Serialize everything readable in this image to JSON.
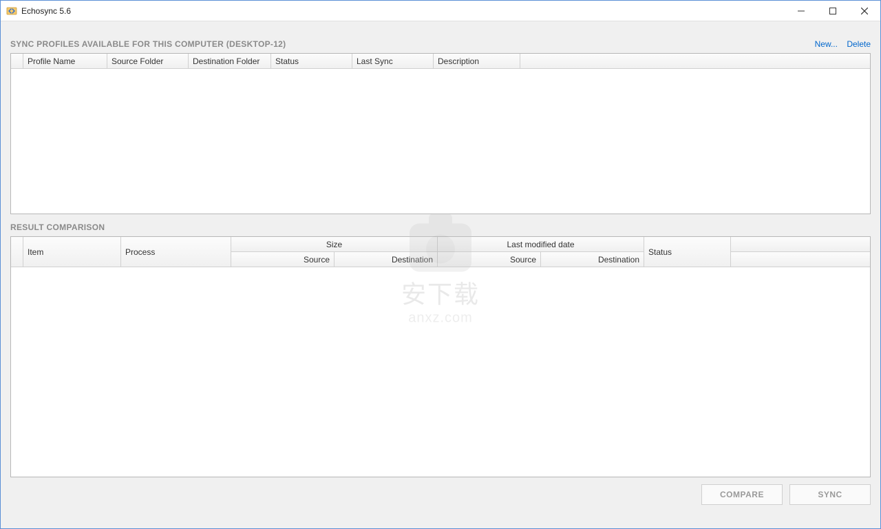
{
  "window": {
    "title": "Echosync 5.6"
  },
  "sections": {
    "profiles_title": "SYNC PROFILES AVAILABLE FOR THIS COMPUTER (DESKTOP-12)",
    "results_title": "RESULT COMPARISON"
  },
  "links": {
    "new": "New...",
    "delete": "Delete"
  },
  "profiles_columns": {
    "selector": "",
    "profile_name": "Profile Name",
    "source_folder": "Source Folder",
    "destination_folder": "Destination Folder",
    "status": "Status",
    "last_sync": "Last Sync",
    "description": "Description"
  },
  "results_columns": {
    "selector": "",
    "item": "Item",
    "process": "Process",
    "size": "Size",
    "size_source": "Source",
    "size_destination": "Destination",
    "last_modified": "Last modified date",
    "lm_source": "Source",
    "lm_destination": "Destination",
    "status": "Status",
    "trailing": ""
  },
  "buttons": {
    "compare": "COMPARE",
    "sync": "SYNC"
  },
  "watermark": {
    "line1": "安下载",
    "line2": "anxz.com"
  }
}
